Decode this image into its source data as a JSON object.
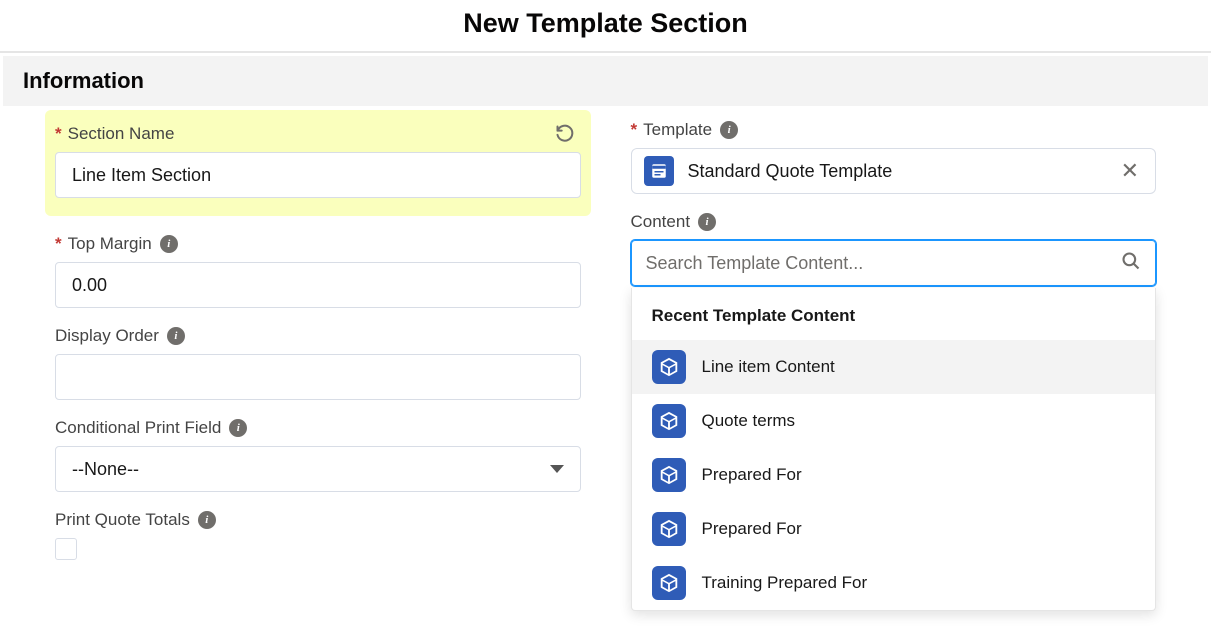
{
  "page": {
    "title": "New Template Section",
    "section_title": "Information"
  },
  "left": {
    "section_name": {
      "label": "Section Name",
      "value": "Line Item Section"
    },
    "top_margin": {
      "label": "Top Margin",
      "value": "0.00"
    },
    "display_order": {
      "label": "Display Order",
      "value": ""
    },
    "conditional_print_field": {
      "label": "Conditional Print Field",
      "value": "--None--"
    },
    "print_quote_totals": {
      "label": "Print Quote Totals"
    }
  },
  "right": {
    "template": {
      "label": "Template",
      "value": "Standard Quote Template"
    },
    "content": {
      "label": "Content",
      "placeholder": "Search Template Content...",
      "dropdown_header": "Recent Template Content",
      "items": [
        {
          "label": "Line item Content"
        },
        {
          "label": "Quote terms"
        },
        {
          "label": "Prepared For"
        },
        {
          "label": "Prepared For"
        },
        {
          "label": "Training Prepared For"
        }
      ]
    }
  }
}
